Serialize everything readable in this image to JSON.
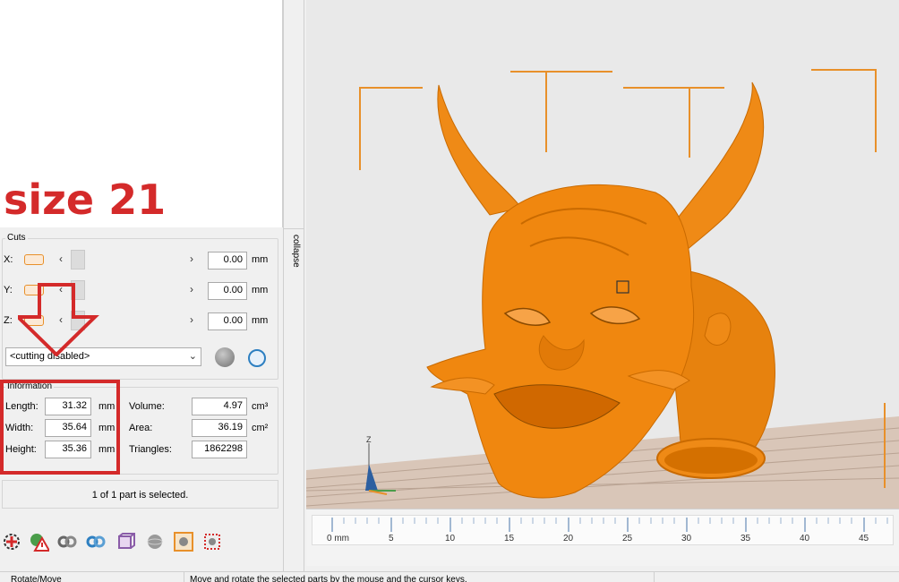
{
  "overlay": {
    "size_text": "size 21"
  },
  "cuts": {
    "title": "Cuts",
    "rows": [
      {
        "axis": "X:",
        "value": "0.00",
        "unit": "mm"
      },
      {
        "axis": "Y:",
        "value": "0.00",
        "unit": "mm"
      },
      {
        "axis": "Z:",
        "value": "0.00",
        "unit": "mm"
      }
    ],
    "mode_select": "<cutting disabled>"
  },
  "information": {
    "title": "Information",
    "length": {
      "label": "Length:",
      "value": "31.32",
      "unit": "mm"
    },
    "width": {
      "label": "Width:",
      "value": "35.64",
      "unit": "mm"
    },
    "height": {
      "label": "Height:",
      "value": "35.36",
      "unit": "mm"
    },
    "volume": {
      "label": "Volume:",
      "value": "4.97",
      "unit": "cm³"
    },
    "area": {
      "label": "Area:",
      "value": "36.19",
      "unit": "cm²"
    },
    "triangles": {
      "label": "Triangles:",
      "value": "1862298"
    }
  },
  "selection_status": "1 of 1 part is selected.",
  "collapse_label": "collapse",
  "viewport": {
    "axis_z": "Z",
    "model_color": "#f0870f",
    "ruler": {
      "unit_label": "0 mm",
      "ticks": [
        "5",
        "10",
        "15",
        "20",
        "25",
        "30",
        "35",
        "40",
        "45"
      ]
    }
  },
  "statusbar": {
    "mode": "Rotate/Move",
    "hint": "Move and rotate the selected parts by the mouse and the cursor keys."
  },
  "toolbar_icons": [
    "gear-cross-icon",
    "warning-globe-icon",
    "link-icon",
    "link-blue-icon",
    "cube-outline-icon",
    "sphere-icon",
    "circle-square-icon",
    "grid-red-icon"
  ],
  "accent_color": "#d42a2a"
}
